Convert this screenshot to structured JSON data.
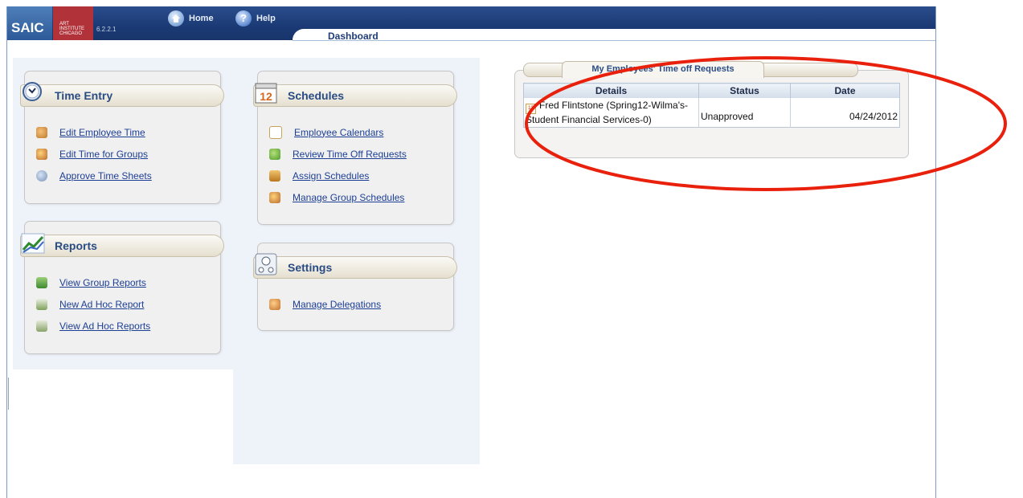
{
  "header": {
    "logo_saic": "SAIC",
    "logo_art_lines": [
      "ART",
      "INSTITUTE",
      "CHICAGO"
    ],
    "version": "6.2.2.1",
    "home_label": "Home",
    "help_label": "Help",
    "active_tab": "Dashboard"
  },
  "panels": {
    "time_entry": {
      "title": "Time Entry",
      "links": [
        "Edit Employee Time",
        "Edit Time for Groups",
        "Approve Time Sheets"
      ]
    },
    "reports": {
      "title": "Reports",
      "links": [
        "View Group Reports",
        "New Ad Hoc Report",
        "View Ad Hoc Reports"
      ]
    },
    "schedules": {
      "title": "Schedules",
      "icon_text": "12",
      "links": [
        "Employee Calendars",
        "Review Time Off Requests",
        "Assign Schedules",
        "Manage Group Schedules"
      ]
    },
    "settings": {
      "title": "Settings",
      "links": [
        "Manage Delegations"
      ]
    }
  },
  "time_off": {
    "title": "My Employees' Time off Requests",
    "columns": [
      "Details",
      "Status",
      "Date"
    ],
    "rows": [
      {
        "details": "Fred Flintstone (Spring12-Wilma's-Student Financial Services-0)",
        "status": "Unapproved",
        "date": "04/24/2012"
      }
    ]
  },
  "colors": {
    "header_bg": "#1b3a75",
    "link": "#1c3f94",
    "panel_title": "#2a4c85",
    "highlight_ellipse": "#e8200c"
  }
}
